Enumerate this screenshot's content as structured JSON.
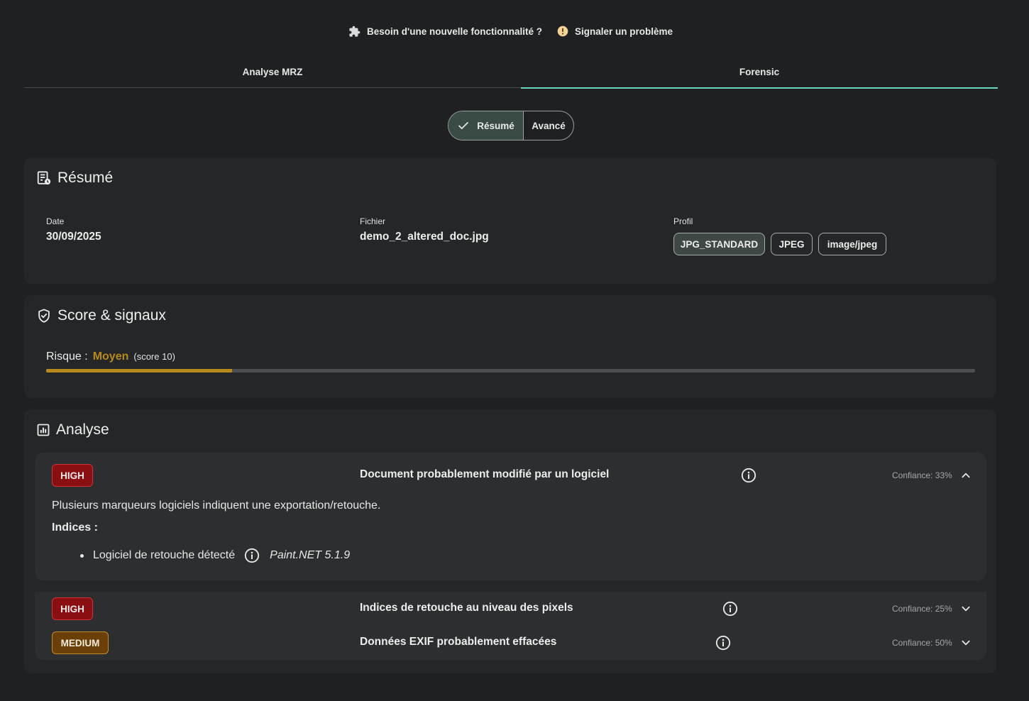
{
  "top_links": {
    "feature_request": "Besoin d'une nouvelle fonctionnalité ?",
    "report_problem": "Signaler un problème"
  },
  "tabs": [
    {
      "label": "Analyse MRZ",
      "active": false
    },
    {
      "label": "Forensic",
      "active": true
    }
  ],
  "view_toggle": {
    "options": [
      "Résumé",
      "Avancé"
    ],
    "selected": "Résumé"
  },
  "summary": {
    "title": "Résumé",
    "date_label": "Date",
    "date_value": "30/09/2025",
    "file_label": "Fichier",
    "file_value": "demo_2_altered_doc.jpg",
    "profile_label": "Profil",
    "profile_chips": [
      "JPG_STANDARD",
      "JPEG",
      "image/jpeg"
    ]
  },
  "score": {
    "title": "Score & signaux",
    "risk_label": "Risque :",
    "risk_level": "Moyen",
    "risk_score_text": "(score 10)",
    "risk_fraction": 0.2,
    "risk_color": "#b88a1e"
  },
  "analysis": {
    "title": "Analyse",
    "items": [
      {
        "severity": "HIGH",
        "title": "Document probablement modifié par un logiciel",
        "confidence": "Confiance: 33%",
        "expanded": true,
        "description": "Plusieurs marqueurs logiciels indiquent une exportation/retouche.",
        "indices_label": "Indices :",
        "indices": [
          {
            "label": "Logiciel de retouche détecté",
            "value": "Paint.NET 5.1.9"
          }
        ]
      },
      {
        "severity": "HIGH",
        "title": "Indices de retouche au niveau des pixels",
        "confidence": "Confiance: 25%",
        "expanded": false
      },
      {
        "severity": "MEDIUM",
        "title": "Données EXIF probablement effacées",
        "confidence": "Confiance: 50%",
        "expanded": false
      }
    ]
  },
  "colors": {
    "accent": "#6fd6bf",
    "high": "#8a0f12",
    "medium": "#6b4008",
    "background": "#1f2021"
  }
}
